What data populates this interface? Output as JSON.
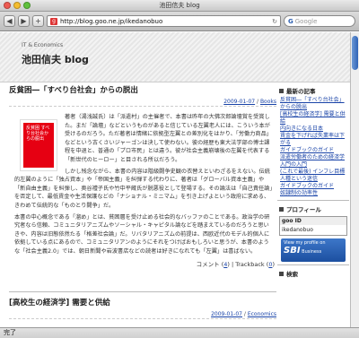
{
  "window": {
    "title": "池田信夫 blog"
  },
  "toolbar": {
    "back": "◀",
    "forward": "▶",
    "add": "+",
    "url": "http://blog.goo.ne.jp/ikedanobuo",
    "search_placeholder": "Google"
  },
  "header": {
    "subtitle": "IT & Economics",
    "title": "池田信夫 blog"
  },
  "post": {
    "title": "反貧困―「すべり台社会」からの脱出",
    "date": "2009-01-07",
    "category": "Books",
    "book_cover_text": "反貧困 すべり台社会からの脱出",
    "paragraphs": [
      "著者（湯浅誠氏）は「派遣村」の主催者で、本書は昨年の大佛次郎論壇賞を受賞した。まだ「論壇」などというものがあると信じている左翼老人には、こういう本が受けるのだろう。ただ著者は情緒に依拠型左翼との差別化をはかり、「労働力商品」などという古くさいジャーゴンは決して使わない。彼の経歴も東大法学部の博士課程を中退と、普通の「プロ市民」とは違う。彼が社会主義崩壊後の左翼を代表する「新世代のヒーロー」と目される所以だろう。",
      "しかし残念ながら、本書の内容は階級闘争史観の衣替えといわざるをえない。伝統的左翼のように「独占資本」や「帝国主義」を糾弾する代わりに、著者は「グローバル資本主義」や「新自由主義」を糾弾し、奥谷禮子氏や竹中平蔵氏が脱悪役として登場する。その論法は「自己責任論」を否定して、最低賃金や生活保護などの「ナショナル・ミニマム」を引き上げよという政府に求める、きわめて伝統的な「ものとり闘争」だ。",
      "本書の中心概念である「溜め」とは、貧困層を受け止める社会的なバッファのことである。政治学の研究者なら信頼、コミュニタリアニズムやソーシャル・キャピタル論などを踏まえているのだろうと思いきや、内容は旧態依然たる「格差社会論」だ。リバタリアニズムの前提は、西欧近代のモデル的個人に依拠している点にあるので、コミュニタリアンのようにそれをつけばおもしろいと思うが、本書のような「社会主義2.0」では、朝日新聞や岩波書店などの読者は好きになれても「左翼」は喜ばない。"
    ],
    "comments_label": "コメント",
    "comments_count": "4",
    "trackback_label": "Trackback",
    "trackback_count": "0"
  },
  "post2": {
    "title": "[高校生の経済学] 需要と供給",
    "date": "2009-01-07",
    "category": "Economics"
  },
  "sidebar": {
    "recent_heading": "最新の記事",
    "recent": [
      "反貧困―「すべり台社会」からの脱出",
      "[高校生の経済学] 需要と供給",
      "内向きになる日本",
      "賃金を下げれば失業率は下がる",
      "ガイドブックのガイド",
      "派遣労働者のための経済学入門の入門",
      "(これで最後) インフレ目標",
      "人種という迷信",
      "ガイドブックのガイド",
      "奴隷制の効率性"
    ],
    "profile_heading": "プロフィール",
    "gooid_label": "goo ID",
    "gooid_value": "ikedanobuo",
    "badge_text": "View my profile on",
    "badge_brand": "SBI",
    "badge_sub": "Business",
    "search_heading": "検索"
  },
  "status": {
    "text": "完了"
  }
}
